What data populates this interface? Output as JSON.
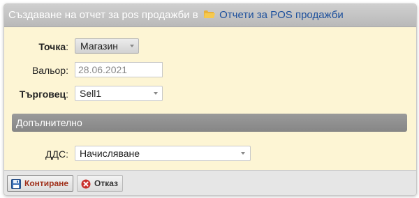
{
  "dialog": {
    "title_prefix": "Създаване на отчет за pos продажби в",
    "title_link": "Отчети за POS продажби"
  },
  "form": {
    "point": {
      "label": "Точка",
      "colon": ":",
      "value": "Магазин"
    },
    "valor": {
      "label": "Вальор:",
      "placeholder": "28.06.2021",
      "value": ""
    },
    "trader": {
      "label": "Търговец",
      "colon": ":",
      "value": "Sell1"
    },
    "section_title": "Допълнително",
    "vat": {
      "label": "ДДС:",
      "value": "Начисляване"
    }
  },
  "footer": {
    "post_label": "Контиране",
    "cancel_label": "Отказ"
  },
  "colors": {
    "body_bg": "#fdf5d4",
    "title_link": "#1b4f9c",
    "primary_button_text": "#a0301a"
  }
}
